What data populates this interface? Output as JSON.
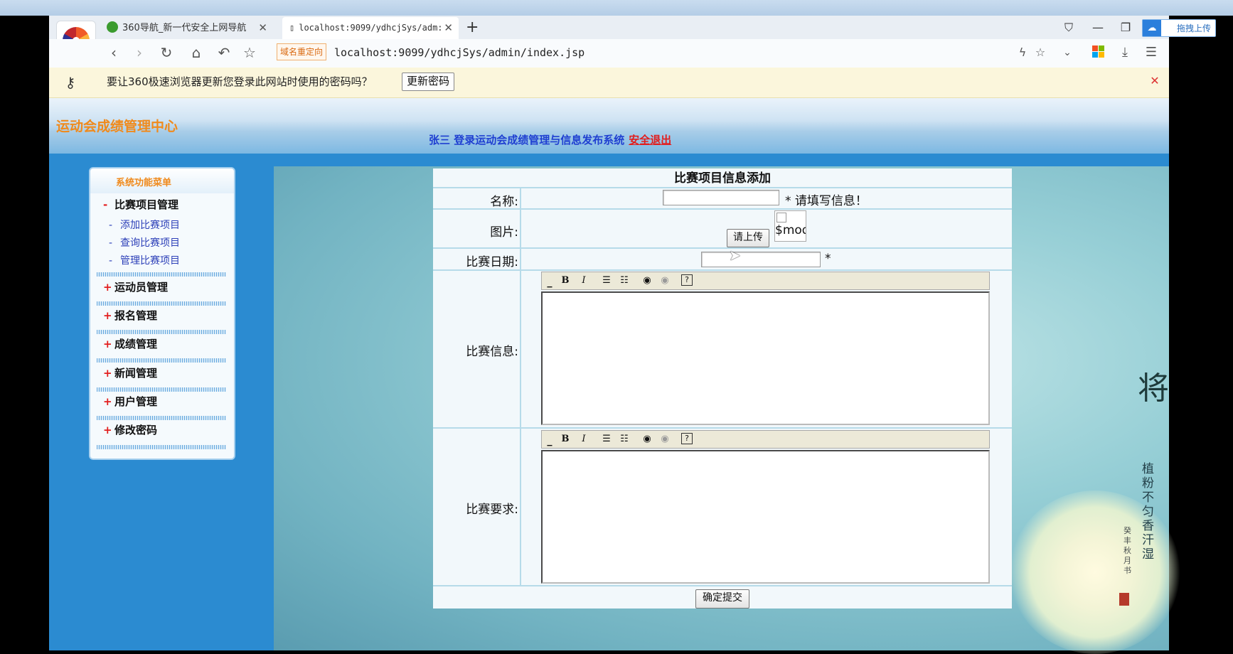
{
  "browser": {
    "tabs": [
      {
        "label": "360导航_新一代安全上网导航"
      },
      {
        "label": "localhost:9099/ydhcjSys/adm:"
      }
    ],
    "redirect_badge": "域名重定向",
    "url": "localhost:9099/ydhcjSys/admin/index.jsp",
    "upload_button": "拖拽上传",
    "infobar": {
      "message": "要让360极速浏览器更新您登录此网站时使用的密码吗？",
      "update_button": "更新密码"
    }
  },
  "header": {
    "site_title": "运动会成绩管理中心",
    "welcome": "张三 登录运动会成绩管理与信息发布系统",
    "logout": "安全退出"
  },
  "sidebar": {
    "title": "系统功能菜单",
    "groups": [
      {
        "sign": "-",
        "label": "比赛项目管理",
        "items": [
          "添加比赛项目",
          "查询比赛项目",
          "管理比赛项目"
        ]
      },
      {
        "sign": "+",
        "label": "运动员管理"
      },
      {
        "sign": "+",
        "label": "报名管理"
      },
      {
        "sign": "+",
        "label": "成绩管理"
      },
      {
        "sign": "+",
        "label": "新闻管理"
      },
      {
        "sign": "+",
        "label": "用户管理"
      },
      {
        "sign": "+",
        "label": "修改密码"
      }
    ]
  },
  "form": {
    "title": "比赛项目信息添加",
    "name_label": "名称:",
    "name_value": "",
    "name_hint": "* 请填写信息！",
    "image_label": "图片:",
    "upload_button": "请上传",
    "image_alt": "$mod",
    "date_label": "比赛日期:",
    "date_value": "",
    "date_required": "*",
    "info_label": "比赛信息:",
    "req_label": "比赛要求:",
    "submit_button": "确定提交"
  },
  "decor": {
    "calligraphy_top": "将",
    "calligraphy_vertical": "植粉不匀香汗湿",
    "calligraphy_small": "癸丰秋月书"
  }
}
